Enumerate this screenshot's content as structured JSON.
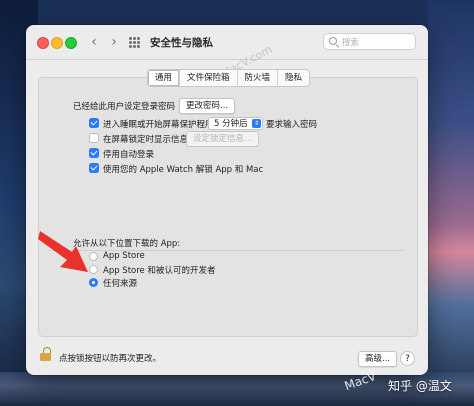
{
  "window": {
    "title": "安全性与隐私"
  },
  "search": {
    "placeholder": "搜索"
  },
  "tabs": [
    {
      "label": "通用",
      "active": true
    },
    {
      "label": "文件保险箱",
      "active": false
    },
    {
      "label": "防火墙",
      "active": false
    },
    {
      "label": "隐私",
      "active": false
    }
  ],
  "general": {
    "password_set_label": "已经给此用户设定登录密码",
    "change_password_button": "更改密码...",
    "require_password": {
      "label": "进入睡眠或开始屏幕保护程序",
      "checked": true,
      "delay_value": "5 分钟后",
      "suffix": "要求输入密码"
    },
    "show_message": {
      "label": "在屏幕锁定时显示信息",
      "checked": false,
      "button": "设定锁定信息..."
    },
    "disable_auto_login": {
      "label": "停用自动登录",
      "checked": true
    },
    "apple_watch": {
      "label": "使用您的 Apple Watch 解锁 App 和 Mac",
      "checked": true
    }
  },
  "downloads": {
    "heading": "允许从以下位置下载的 App:",
    "options": [
      {
        "label": "App Store",
        "selected": false
      },
      {
        "label": "App Store 和被认可的开发者",
        "selected": false
      },
      {
        "label": "任何来源",
        "selected": true
      }
    ]
  },
  "footer": {
    "lock_text": "点按锁按钮以防再次更改。",
    "advanced_button": "高级...",
    "help_button": "?"
  },
  "watermarks": {
    "diagonal": "MacV.com",
    "bottom": "MacV",
    "zhihu": "知乎 @温文"
  },
  "colors": {
    "accent": "#2a7cf6",
    "arrow": "#e8322b",
    "window_bg": "#ececec"
  }
}
